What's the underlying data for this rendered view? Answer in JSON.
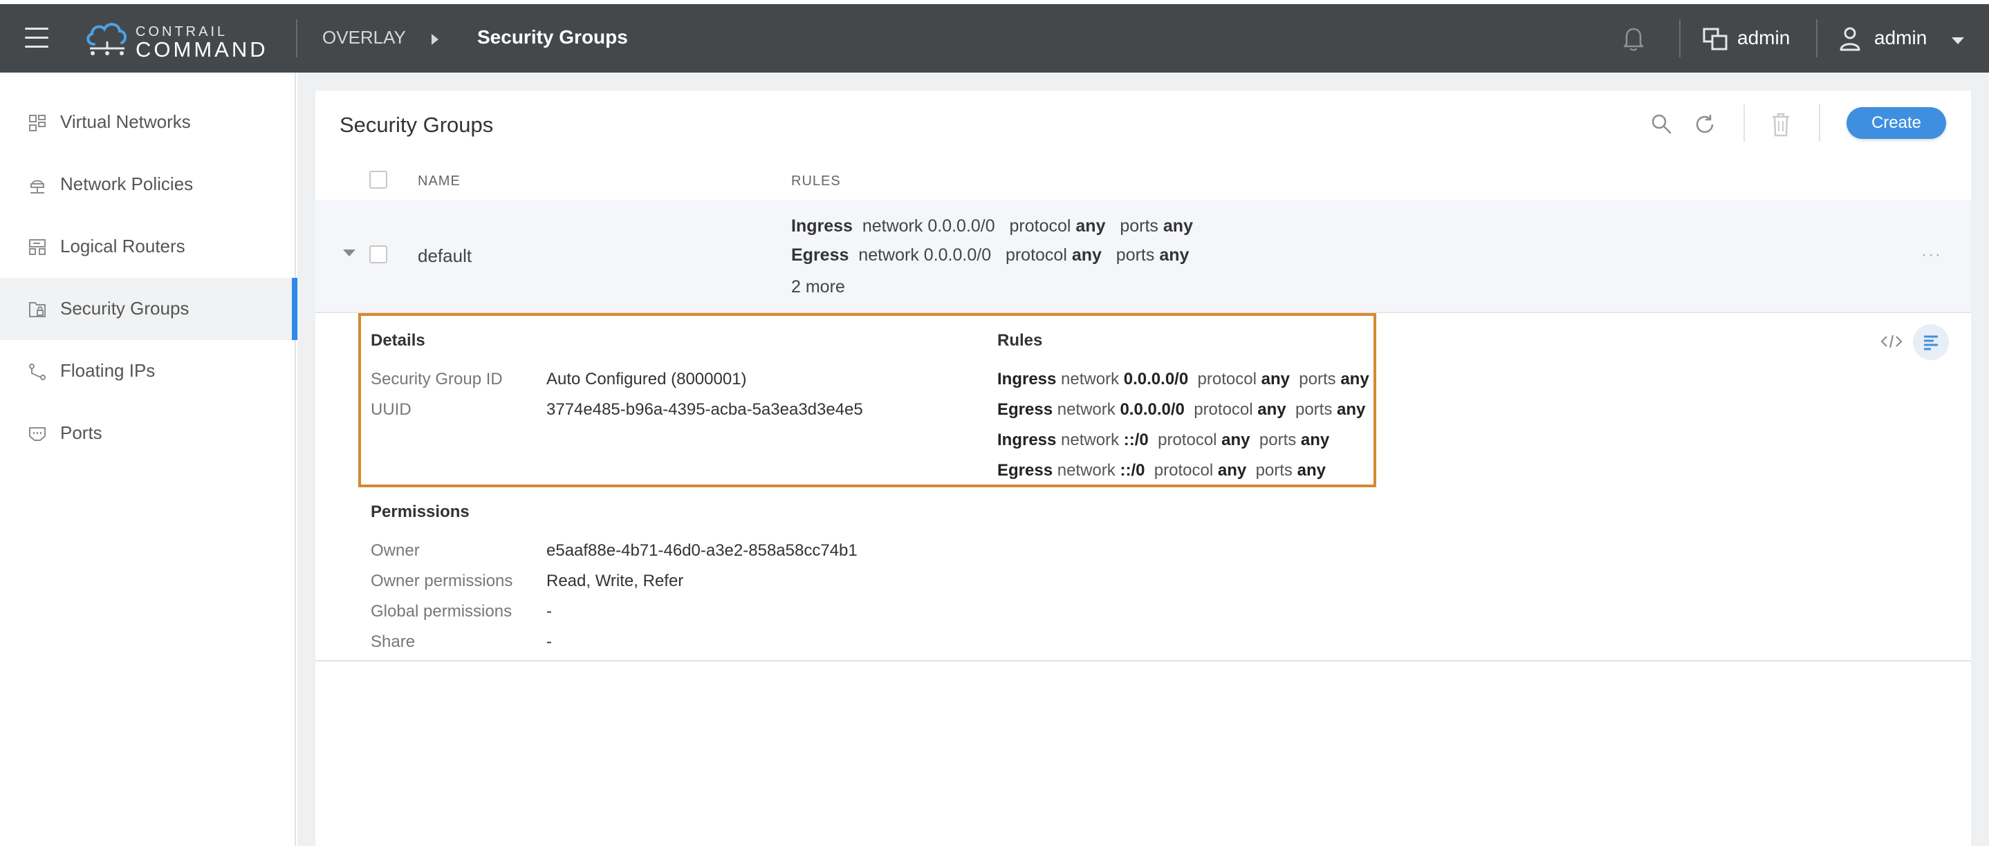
{
  "header": {
    "logo_top": "CONTRAIL",
    "logo_bottom": "COMMAND",
    "breadcrumb_parent": "OVERLAY",
    "breadcrumb_current": "Security Groups",
    "project_label": "admin",
    "user_label": "admin"
  },
  "sidebar": {
    "items": [
      {
        "label": "Virtual Networks",
        "icon": "virtual-networks-icon"
      },
      {
        "label": "Network Policies",
        "icon": "network-policies-icon"
      },
      {
        "label": "Logical Routers",
        "icon": "logical-routers-icon"
      },
      {
        "label": "Security Groups",
        "icon": "security-groups-icon",
        "active": true
      },
      {
        "label": "Floating IPs",
        "icon": "floating-ips-icon"
      },
      {
        "label": "Ports",
        "icon": "ports-icon"
      }
    ]
  },
  "panel": {
    "title": "Security Groups",
    "create_label": "Create",
    "columns": {
      "name": "NAME",
      "rules": "RULES"
    }
  },
  "row": {
    "name": "default",
    "rules": [
      {
        "direction": "Ingress",
        "network_word": "network",
        "network": "0.0.0.0/0",
        "protocol_word": "protocol",
        "protocol": "any",
        "ports_word": "ports",
        "ports": "any"
      },
      {
        "direction": "Egress",
        "network_word": "network",
        "network": "0.0.0.0/0",
        "protocol_word": "protocol",
        "protocol": "any",
        "ports_word": "ports",
        "ports": "any"
      }
    ],
    "more": "2 more",
    "menu": "···"
  },
  "details": {
    "details_title": "Details",
    "rules_title": "Rules",
    "security_group_id_label": "Security Group ID",
    "security_group_id": "Auto Configured (8000001)",
    "uuid_label": "UUID",
    "uuid": "3774e485-b96a-4395-acba-5a3ea3d3e4e5",
    "rules": [
      {
        "direction": "Ingress",
        "network_word": "network",
        "network": "0.0.0.0/0",
        "protocol_word": "protocol",
        "protocol": "any",
        "ports_word": "ports",
        "ports": "any"
      },
      {
        "direction": "Egress",
        "network_word": "network",
        "network": "0.0.0.0/0",
        "protocol_word": "protocol",
        "protocol": "any",
        "ports_word": "ports",
        "ports": "any"
      },
      {
        "direction": "Ingress",
        "network_word": "network",
        "network": "::/0",
        "protocol_word": "protocol",
        "protocol": "any",
        "ports_word": "ports",
        "ports": "any"
      },
      {
        "direction": "Egress",
        "network_word": "network",
        "network": "::/0",
        "protocol_word": "protocol",
        "protocol": "any",
        "ports_word": "ports",
        "ports": "any"
      }
    ],
    "permissions_title": "Permissions",
    "owner_label": "Owner",
    "owner": "e5aaf88e-4b71-46d0-a3e2-858a58cc74b1",
    "owner_permissions_label": "Owner permissions",
    "owner_permissions": "Read, Write, Refer",
    "global_permissions_label": "Global permissions",
    "global_permissions": "-",
    "share_label": "Share",
    "share": "-"
  },
  "colors": {
    "topbar": "#45484b",
    "accent": "#3f8fe0",
    "highlight": "#d4892e",
    "active_bar": "#2e8ae6"
  }
}
